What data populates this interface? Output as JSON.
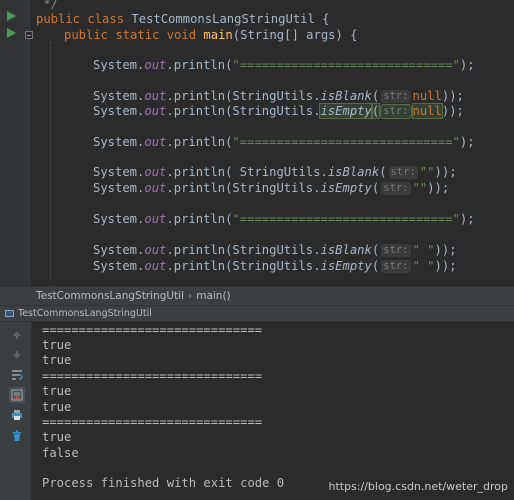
{
  "editor": {
    "lines": {
      "class_decl": {
        "kw": "public class ",
        "name": "TestCommonsLangStringUtil",
        "tail": " {"
      },
      "main_decl": {
        "kw": "public static void ",
        "name": "main",
        "tail": "(String[] args) {"
      },
      "sep1": {
        "pre": "System.",
        "fld": "out",
        "mid": ".println(",
        "str": "\"=============================\"",
        "tail": ");"
      },
      "blank_null": {
        "pre": "System.",
        "fld": "out",
        "mid": ".println(StringUtils.",
        "method": "isBlank",
        "open": "(",
        "hint": "str:",
        "arg": "null",
        "tail": "));"
      },
      "empty_null": {
        "pre": "System.",
        "fld": "out",
        "mid": ".println(StringUtils.",
        "method": "isEmpty",
        "open": "(",
        "hint": "str:",
        "arg": "null",
        "tail": "));"
      },
      "sep2": {
        "pre": "System.",
        "fld": "out",
        "mid": ".println(",
        "str": "\"=============================\"",
        "tail": ");"
      },
      "blank_empty": {
        "pre": "System.",
        "fld": "out",
        "mid": ".println( StringUtils.",
        "method": "isBlank",
        "open": "(",
        "hint": "str:",
        "arg": "\"\"",
        "tail": "));"
      },
      "empty_empty": {
        "pre": "System.",
        "fld": "out",
        "mid": ".println(StringUtils.",
        "method": "isEmpty",
        "open": "(",
        "hint": "str:",
        "arg": "\"\"",
        "tail": "));"
      },
      "sep3": {
        "pre": "System.",
        "fld": "out",
        "mid": ".println(",
        "str": "\"=============================\"",
        "tail": ");"
      },
      "blank_space": {
        "pre": "System.",
        "fld": "out",
        "mid": ".println(StringUtils.",
        "method": "isBlank",
        "open": "(",
        "hint": "str:",
        "arg": "\" \"",
        "tail": "));"
      },
      "empty_space": {
        "pre": "System.",
        "fld": "out",
        "mid": ".println(StringUtils.",
        "method": "isEmpty",
        "open": "(",
        "hint": "str:",
        "arg": "\" \"",
        "tail": "));"
      }
    }
  },
  "breadcrumb": {
    "class_name": "TestCommonsLangStringUtil",
    "separator": "›",
    "method": "main()"
  },
  "run_panel": {
    "tab_label": "TestCommonsLangStringUtil",
    "toolbar_icons": [
      "up-arrow-icon",
      "down-arrow-icon",
      "soft-wrap-icon",
      "scroll-to-end-icon",
      "print-icon",
      "trash-icon"
    ],
    "output": [
      "==============================",
      "true",
      "true",
      "==============================",
      "true",
      "true",
      "==============================",
      "true",
      "false",
      "",
      "Process finished with exit code 0"
    ]
  },
  "watermark": "https://blog.csdn.net/weter_drop",
  "colors": {
    "keyword": "#cc7832",
    "method": "#ffc66d",
    "field": "#9876aa",
    "string": "#6a8759",
    "run_green": "#499c54"
  }
}
